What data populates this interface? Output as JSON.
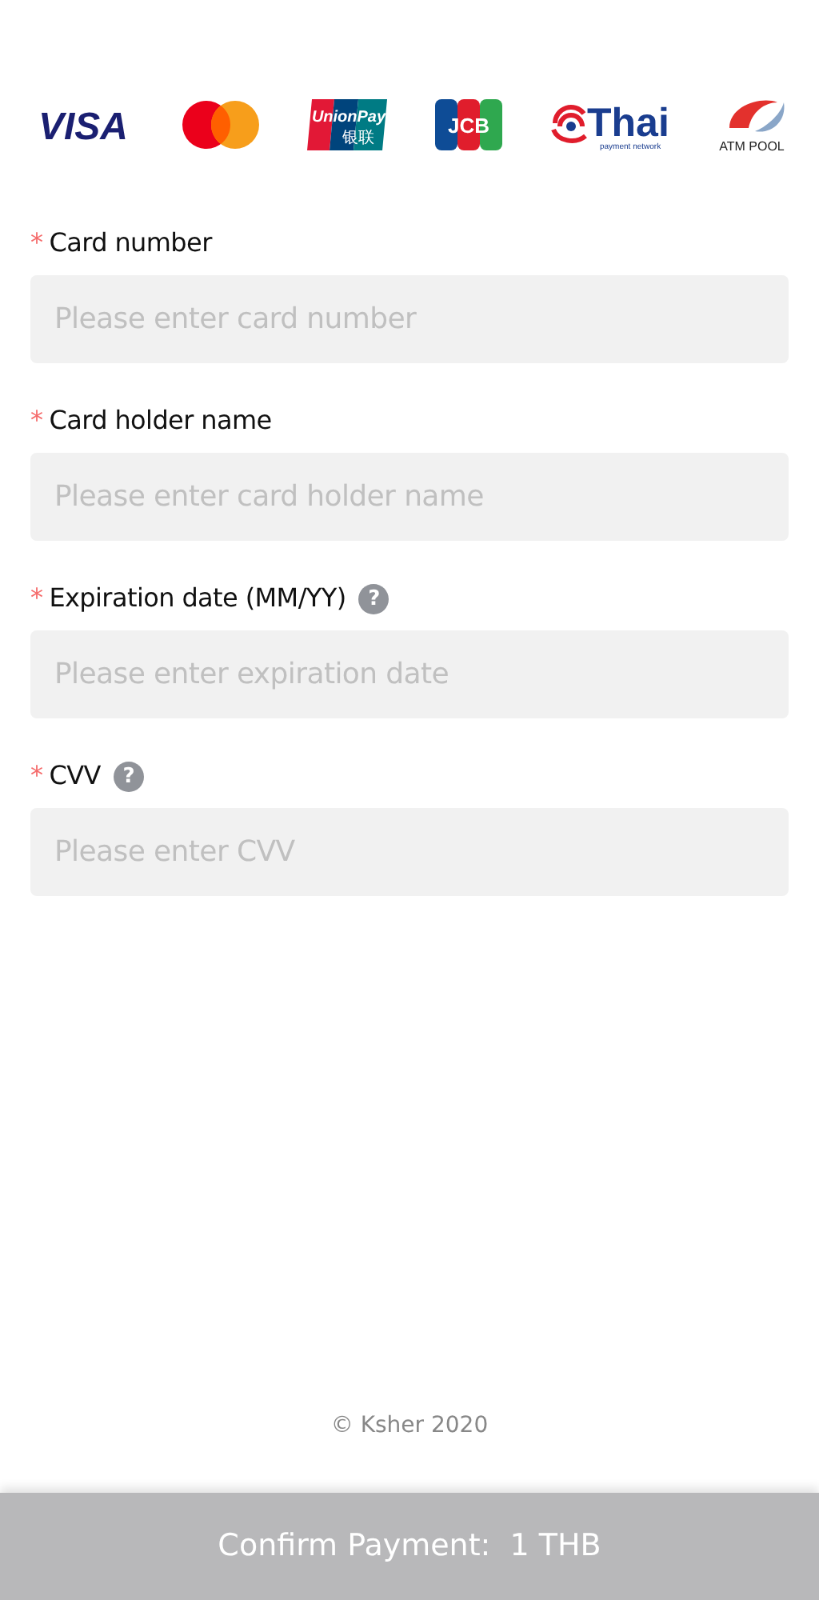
{
  "card_brands": [
    {
      "kind": "visa",
      "texts": [
        "VISA"
      ]
    },
    {
      "kind": "mastercard"
    },
    {
      "kind": "unionpay",
      "texts": [
        "UnionPay",
        "银联"
      ]
    },
    {
      "kind": "jcb",
      "texts": [
        "JCB"
      ]
    },
    {
      "kind": "thai",
      "texts": [
        "Thai",
        "payment network"
      ]
    },
    {
      "kind": "atmpool",
      "texts": [
        "ATM POOL"
      ]
    }
  ],
  "fields": [
    {
      "required_mark": "*",
      "label": "Card number",
      "placeholder": "Please enter card number"
    },
    {
      "required_mark": "*",
      "label": "Card holder name",
      "placeholder": "Please enter card holder name"
    },
    {
      "required_mark": "*",
      "label": "Expiration date (MM/YY)",
      "help": "?",
      "placeholder": "Please enter expiration date"
    },
    {
      "required_mark": "*",
      "label": "CVV",
      "help": "?",
      "placeholder": "Please enter CVV"
    }
  ],
  "footer": "© Ksher 2020",
  "confirm_button": {
    "label": "Confirm Payment:  1 THB",
    "disabled": true
  }
}
